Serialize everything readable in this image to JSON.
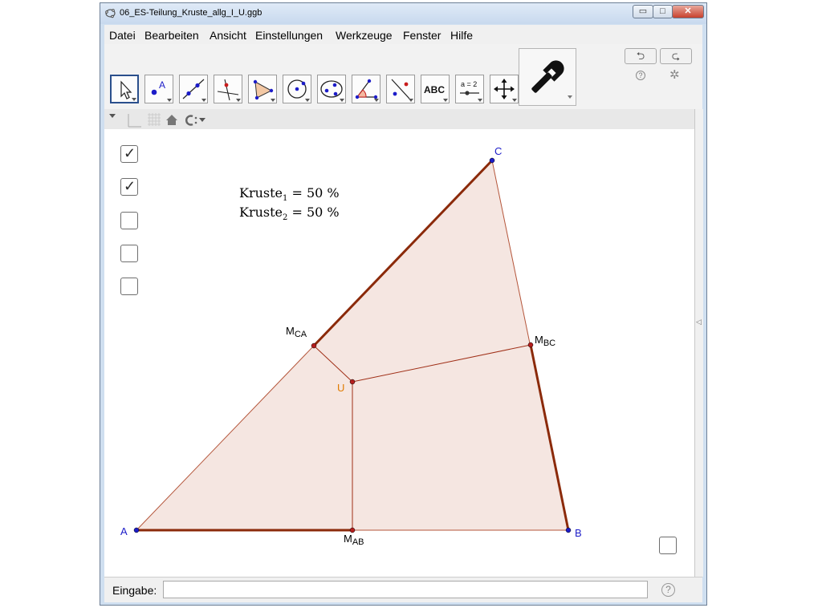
{
  "window": {
    "title": "06_ES-Teilung_Kruste_allg_I_U.ggb",
    "minimize": "▭",
    "maximize": "□",
    "close": "✕"
  },
  "menu": [
    "Datei",
    "Bearbeiten",
    "Ansicht",
    "Einstellungen",
    "Werkzeuge",
    "Fenster",
    "Hilfe"
  ],
  "toolbar": {
    "tools": [
      {
        "icon": "move-pointer-icon"
      },
      {
        "icon": "new-point-icon",
        "label": "A"
      },
      {
        "icon": "line-through-two-points-icon"
      },
      {
        "icon": "perpendicular-line-icon"
      },
      {
        "icon": "polygon-icon"
      },
      {
        "icon": "circle-with-center-icon"
      },
      {
        "icon": "ellipse-icon"
      },
      {
        "icon": "angle-icon"
      },
      {
        "icon": "reflect-about-line-icon"
      },
      {
        "icon": "text-icon",
        "label": "ABC"
      },
      {
        "icon": "slider-icon",
        "label": "a = 2"
      },
      {
        "icon": "move-graphics-view-icon"
      }
    ],
    "undo": "⮌",
    "redo": "⮎",
    "help": "?",
    "settings": "✲"
  },
  "checkboxes": [
    {
      "checked": true
    },
    {
      "checked": true
    },
    {
      "checked": false
    },
    {
      "checked": false
    },
    {
      "checked": false
    }
  ],
  "kruste": [
    {
      "name": "Kruste",
      "sub": "1",
      "value": " = 50 %"
    },
    {
      "name": "Kruste",
      "sub": "2",
      "value": " = 50 %"
    }
  ],
  "points": {
    "A": {
      "label": "A",
      "sub": ""
    },
    "B": {
      "label": "B",
      "sub": ""
    },
    "C": {
      "label": "C",
      "sub": ""
    },
    "M_AB": {
      "label": "M",
      "sub": "AB"
    },
    "M_BC": {
      "label": "M",
      "sub": "BC"
    },
    "M_CA": {
      "label": "M",
      "sub": "CA"
    },
    "U": {
      "label": "U",
      "sub": ""
    }
  },
  "colors": {
    "fill": "#f5e6e1",
    "edge": "#8b2a0a",
    "point_blue": "#1c1cc8",
    "point_red": "#b51e1e",
    "label_blue": "#1c1cc8",
    "label_black": "#000000",
    "label_orange": "#e07b00"
  },
  "input": {
    "label": "Eingabe:",
    "value": "",
    "help": "?"
  }
}
